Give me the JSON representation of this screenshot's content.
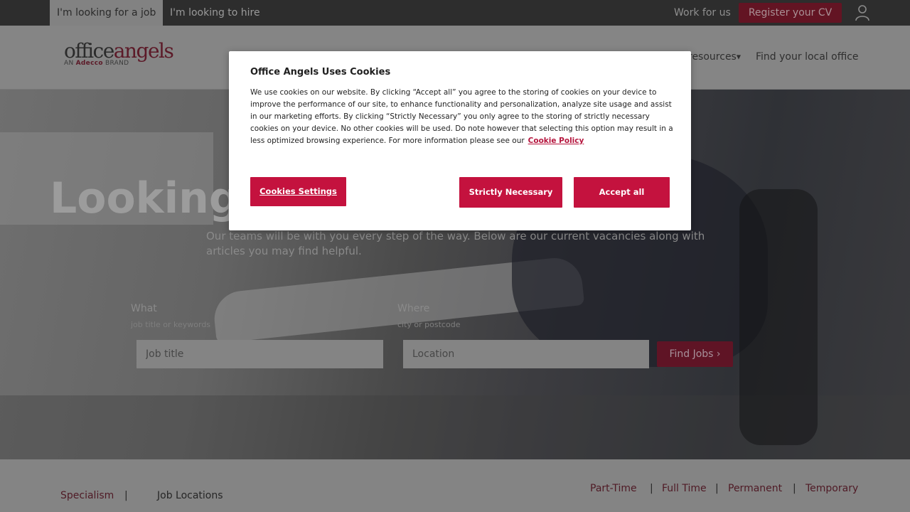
{
  "topbar": {
    "tabs": [
      "I'm looking for a job",
      "I'm looking to hire"
    ],
    "work_for_us": "Work for us",
    "register_cv": "Register your CV",
    "user_icon": "user-icon"
  },
  "header": {
    "logo": {
      "office": "office",
      "angels": "angels",
      "sub_prefix": "AN",
      "sub_brand": "Adecco",
      "sub_suffix": "BRAND"
    },
    "nav": {
      "resources": "resources",
      "find_office": "Find your local office"
    }
  },
  "hero": {
    "title": "Looking",
    "lead": "Our teams will be with you every step of the way. Below are our current vacancies along with articles you may find helpful."
  },
  "search": {
    "what_label": "What",
    "what_hint": "job title or keywords",
    "what_placeholder": "Job title",
    "where_label": "Where",
    "where_hint": "city or postcode",
    "where_placeholder": "Location",
    "find_button": "Find Jobs ›"
  },
  "bottom": {
    "specialism": "Specialism",
    "job_locations": "Job Locations",
    "separator": "|",
    "filters": [
      "Part-Time",
      "Full Time",
      "Permanent",
      "Temporary"
    ]
  },
  "cookie_dialog": {
    "title": "Office Angels Uses Cookies",
    "body": "We use cookies on our website. By clicking “Accept all” you agree to the storing of cookies on your device to improve the performance of our site, to enhance functionality and personalization, analyze site usage and assist in our marketing efforts. By clicking “Strictly Necessary” you only agree to the storing of strictly necessary cookies on your device. No other cookies will be used. Do note however that selecting this option may result in a less optimized browsing experience. For more information please see our",
    "policy_link": "Cookie Policy",
    "settings_button": "Cookies Settings",
    "strict_button": "Strictly Necessary",
    "accept_button": "Accept all"
  },
  "colors": {
    "brand": "#c4123e",
    "overlay_dark": "#2d2d2d"
  }
}
